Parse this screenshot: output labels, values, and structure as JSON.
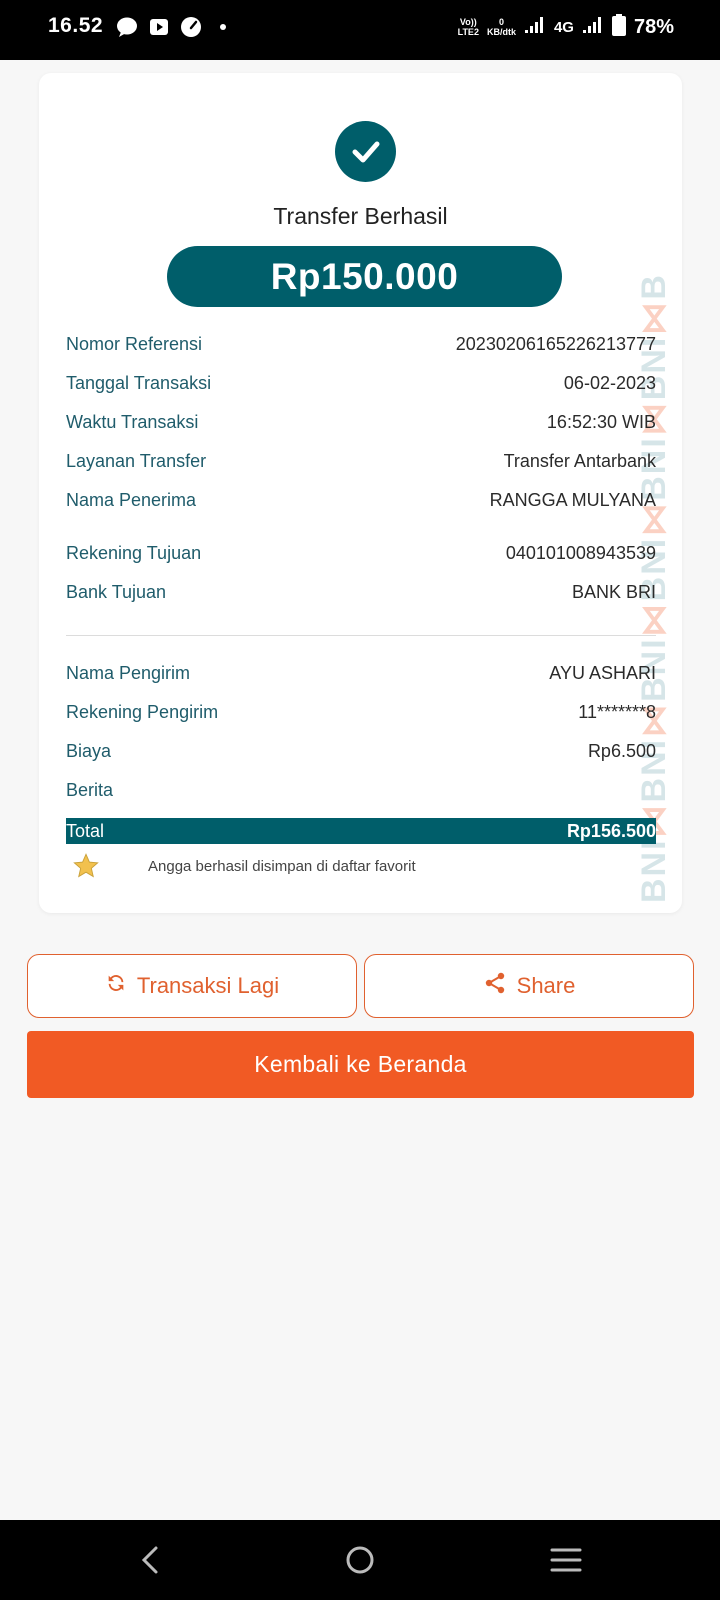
{
  "status_bar": {
    "time": "16.52",
    "volte_line1": "Vo))",
    "volte_line2": "LTE2",
    "speed_value": "0",
    "speed_unit": "KB/dtk",
    "network": "4G",
    "battery": "78%"
  },
  "receipt": {
    "title": "Transfer Berhasil",
    "amount": "Rp150.000",
    "watermark": [
      "BNI",
      "BNI",
      "BNI",
      "BNI",
      "BNI",
      "BNI",
      "B"
    ],
    "details": [
      {
        "label": "Nomor Referensi",
        "value": "20230206165226213777"
      },
      {
        "label": "Tanggal Transaksi",
        "value": "06-02-2023"
      },
      {
        "label": "Waktu Transaksi",
        "value": "16:52:30 WIB"
      },
      {
        "label": "Layanan Transfer",
        "value": "Transfer Antarbank"
      },
      {
        "label": "Nama Penerima",
        "value": "RANGGA MULYANA"
      },
      {
        "label": "Rekening Tujuan",
        "value": "040101008943539"
      },
      {
        "label": "Bank Tujuan",
        "value": "BANK BRI"
      }
    ],
    "sender": [
      {
        "label": "Nama Pengirim",
        "value": "AYU ASHARI"
      },
      {
        "label": "Rekening Pengirim",
        "value": "11*******8"
      },
      {
        "label": "Biaya",
        "value": "Rp6.500"
      },
      {
        "label": "Berita",
        "value": ""
      }
    ],
    "total_label": "Total",
    "total_value": "Rp156.500",
    "favorite_text": "Angga berhasil disimpan di daftar favorit"
  },
  "actions": {
    "again_label": "Transaksi Lagi",
    "share_label": "Share",
    "home_label": "Kembali ke Beranda"
  },
  "colors": {
    "teal": "#005e6a",
    "orange": "#f15a24",
    "star": "#f2c14e"
  }
}
